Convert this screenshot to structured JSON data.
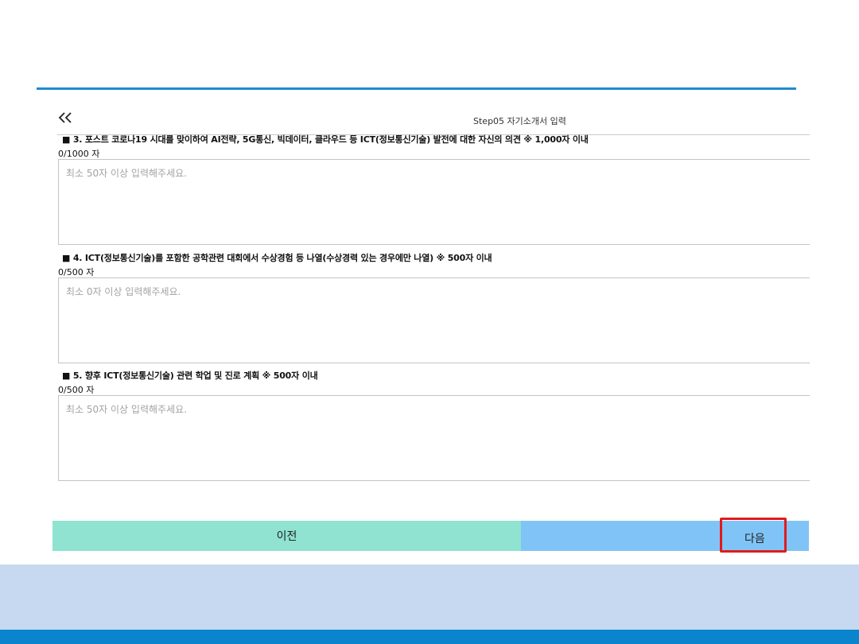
{
  "header": {
    "step_title": "Step05 자기소개서 입력"
  },
  "icons": {
    "back": "double-chevron-left-icon"
  },
  "questions": [
    {
      "label": "■ 3. 포스트 코로나19 시대를 맞이하여 AI전략, 5G통신, 빅데이터, 클라우드 등 ICT(정보통신기술) 발전에 대한 자신의 의견 ※ 1,000자 이내",
      "counter": "0/1000 자",
      "value": "",
      "placeholder": "최소 50자 이상 입력해주세요."
    },
    {
      "label": "■ 4. ICT(정보통신기술)를 포함한 공학관련 대회에서 수상경험 등 나열(수상경력 있는 경우에만 나열) ※ 500자 이내",
      "counter": "0/500 자",
      "value": "",
      "placeholder": "최소 0자 이상 입력해주세요."
    },
    {
      "label": "■ 5. 향후 ICT(정보통신기술) 관련 학업 및 진로 계획 ※ 500자 이내",
      "counter": "0/500 자",
      "value": "",
      "placeholder": "최소 50자 이상 입력해주세요."
    }
  ],
  "buttons": {
    "prev_label": "이전",
    "next_label": "다음"
  },
  "colors": {
    "accent": "#1f8bd0",
    "prev_button": "#8fe3d0",
    "next_button": "#80c4f7",
    "highlight": "#e21a1a",
    "footer_light": "#c6d9f0",
    "footer_dark": "#0a84cc"
  }
}
